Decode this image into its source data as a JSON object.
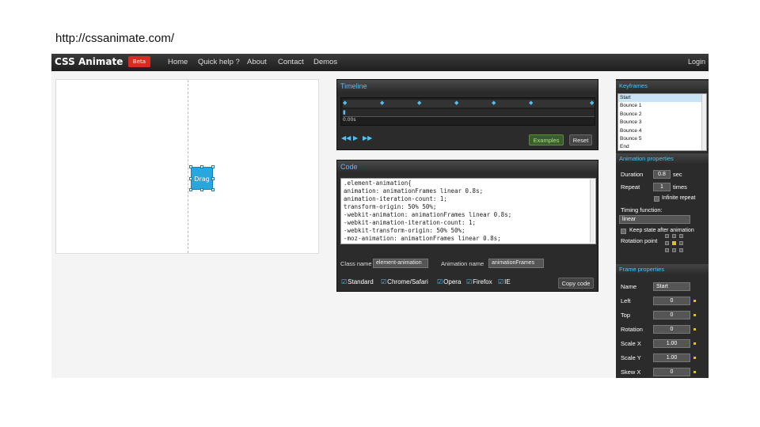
{
  "page": {
    "url": "http://cssanimate.com/"
  },
  "header": {
    "logo": "CSS Animate",
    "badge": "Beta",
    "nav": [
      "Home",
      "Quick help ?",
      "About",
      "Contact",
      "Demos"
    ],
    "login": "Login"
  },
  "stage": {
    "element_label": "Drag"
  },
  "timeline": {
    "title": "Timeline",
    "time": "0.00s",
    "examples_button": "Examples",
    "reset_button": "Reset"
  },
  "code": {
    "title": "Code",
    "lines": [
      ".element-animation{",
      "  animation: animationFrames linear 0.8s;",
      "  animation-iteration-count: 1;",
      "  transform-origin: 50% 50%;",
      "  -webkit-animation: animationFrames linear 0.8s;",
      "  -webkit-animation-iteration-count: 1;",
      "  -webkit-transform-origin: 50% 50%;",
      "  -moz-animation: animationFrames linear 0.8s;"
    ],
    "class_name_label": "Class name",
    "class_name_value": "element-animation",
    "animation_name_label": "Animation name",
    "animation_name_value": "animationFrames",
    "checkboxes": [
      "Standard",
      "Chrome/Safari",
      "Opera",
      "Firefox",
      "IE"
    ],
    "copy_button": "Copy code"
  },
  "keyframes": {
    "title": "Keyframes",
    "items": [
      "Start",
      "Bounce 1",
      "Bounce 2",
      "Bounce 3",
      "Bounce 4",
      "Bounce 5",
      "End"
    ]
  },
  "animation_properties": {
    "title": "Animation properties",
    "duration_label": "Duration",
    "duration_value": "0.8",
    "duration_unit": "sec",
    "repeat_label": "Repeat",
    "repeat_value": "1",
    "repeat_unit": "times",
    "infinite_label": "Infinite repeat",
    "timing_label": "Timing function:",
    "timing_value": "linear",
    "keep_state_label": "Keep state after animation",
    "rotation_point_label": "Rotation point"
  },
  "frame_properties": {
    "title": "Frame properties",
    "name_label": "Name",
    "name_value": "Start",
    "rows": [
      {
        "label": "Left",
        "value": "0"
      },
      {
        "label": "Top",
        "value": "0"
      },
      {
        "label": "Rotation",
        "value": "0"
      },
      {
        "label": "Scale X",
        "value": "1.00"
      },
      {
        "label": "Scale Y",
        "value": "1.00"
      },
      {
        "label": "Skew X",
        "value": "0"
      }
    ]
  },
  "colors": {
    "accent": "#4fc3f7",
    "drag_element": "#2aa6dc",
    "beta_badge": "#d92b1f",
    "panel": "#2b2b2b"
  }
}
